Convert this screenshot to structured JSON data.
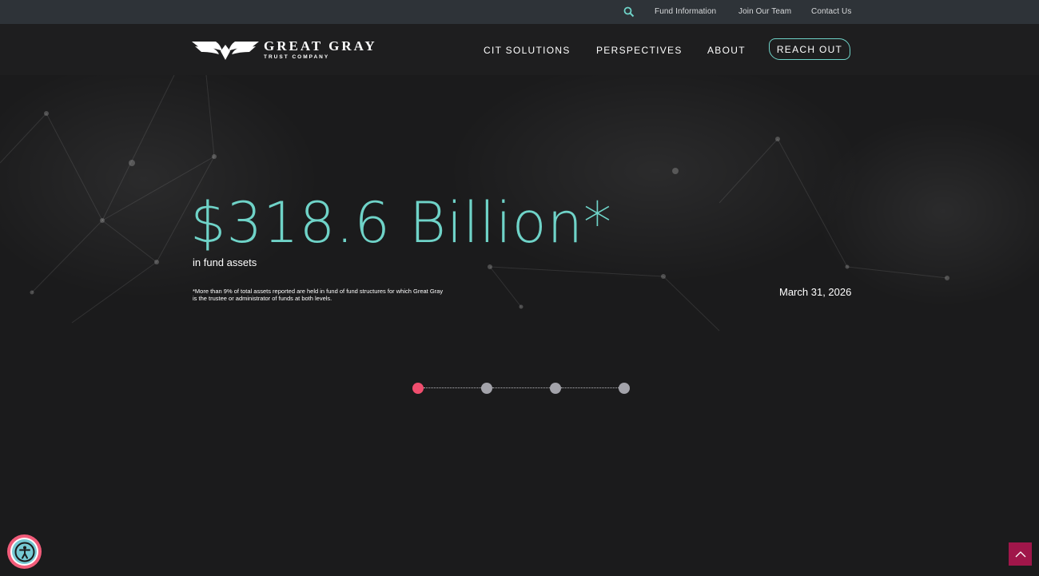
{
  "utility_bar": {
    "search_icon": "search-icon",
    "links": [
      "Fund Information",
      "Join Our Team",
      "Contact Us"
    ]
  },
  "logo": {
    "name": "GREAT GRAY",
    "subtitle": "TRUST COMPANY"
  },
  "nav": {
    "items": [
      "CIT SOLUTIONS",
      "PERSPECTIVES",
      "ABOUT"
    ],
    "cta": "REACH OUT"
  },
  "hero": {
    "stat": "$318.6 Billion*",
    "stat_label": "in fund assets",
    "footnote": "*More than 9% of total assets reported are held in fund of fund structures for which Great Gray is the trustee or administrator of funds at both levels.",
    "date": "March 31, 2026"
  },
  "pager": {
    "count": 4,
    "active_index": 0
  },
  "colors": {
    "accent_teal": "#6fd3c8",
    "active_dot": "#f04e6e",
    "to_top_bg": "#a0164a",
    "utility_bg": "#2e3338"
  }
}
